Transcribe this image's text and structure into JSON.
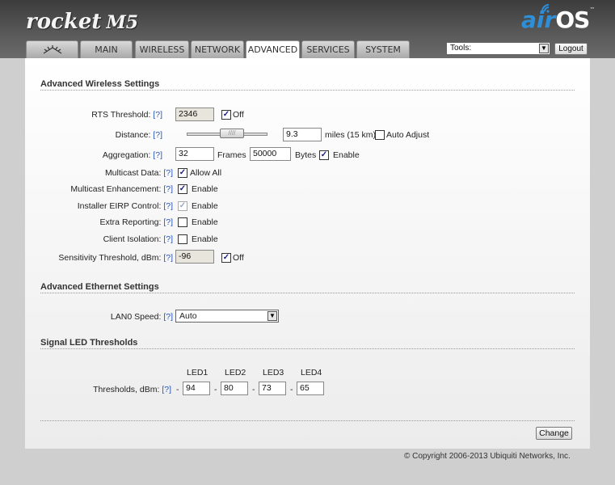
{
  "header": {
    "brand": "rocket",
    "model": "M5",
    "product_air": "air",
    "product_os": "OS",
    "tm": "™"
  },
  "tabs": [
    {
      "label": "",
      "icon": "ubiquiti-logo-icon"
    },
    {
      "label": "MAIN"
    },
    {
      "label": "WIRELESS"
    },
    {
      "label": "NETWORK"
    },
    {
      "label": "ADVANCED",
      "active": true
    },
    {
      "label": "SERVICES"
    },
    {
      "label": "SYSTEM"
    }
  ],
  "toolbar": {
    "tools_value": "Tools:",
    "logout_label": "Logout"
  },
  "help_label": "[?]",
  "wireless": {
    "title": "Advanced Wireless Settings",
    "rts": {
      "label": "RTS Threshold:",
      "value": "2346",
      "off_label": "Off",
      "off_checked": true
    },
    "distance": {
      "label": "Distance:",
      "value": "9.3",
      "unit": "miles (15 km)",
      "auto_label": "Auto Adjust",
      "auto_checked": false
    },
    "aggregation": {
      "label": "Aggregation:",
      "frames_value": "32",
      "frames_label": "Frames",
      "bytes_value": "50000",
      "bytes_label": "Bytes",
      "enable_label": "Enable",
      "enable_checked": true
    },
    "multicast_data": {
      "label": "Multicast Data:",
      "option_label": "Allow All",
      "checked": true
    },
    "multicast_enh": {
      "label": "Multicast Enhancement:",
      "option_label": "Enable",
      "checked": true
    },
    "eirp": {
      "label": "Installer EIRP Control:",
      "option_label": "Enable",
      "checked": true
    },
    "extra": {
      "label": "Extra Reporting:",
      "option_label": "Enable",
      "checked": false
    },
    "isolation": {
      "label": "Client Isolation:",
      "option_label": "Enable",
      "checked": false
    },
    "sensitivity": {
      "label": "Sensitivity Threshold, dBm:",
      "value": "-96",
      "off_label": "Off",
      "off_checked": true
    }
  },
  "ethernet": {
    "title": "Advanced Ethernet Settings",
    "lan0": {
      "label": "LAN0 Speed:",
      "value": "Auto"
    }
  },
  "led": {
    "title": "Signal LED Thresholds",
    "label": "Thresholds, dBm:",
    "headers": [
      "LED1",
      "LED2",
      "LED3",
      "LED4"
    ],
    "values": [
      "94",
      "80",
      "73",
      "65"
    ],
    "dash": "-"
  },
  "footer": {
    "change_label": "Change",
    "copyright": "© Copyright 2006-2013 Ubiquiti Networks, Inc."
  },
  "colors": {
    "help_link": "#2a57b8",
    "airos_blue": "#2e8fd8"
  }
}
